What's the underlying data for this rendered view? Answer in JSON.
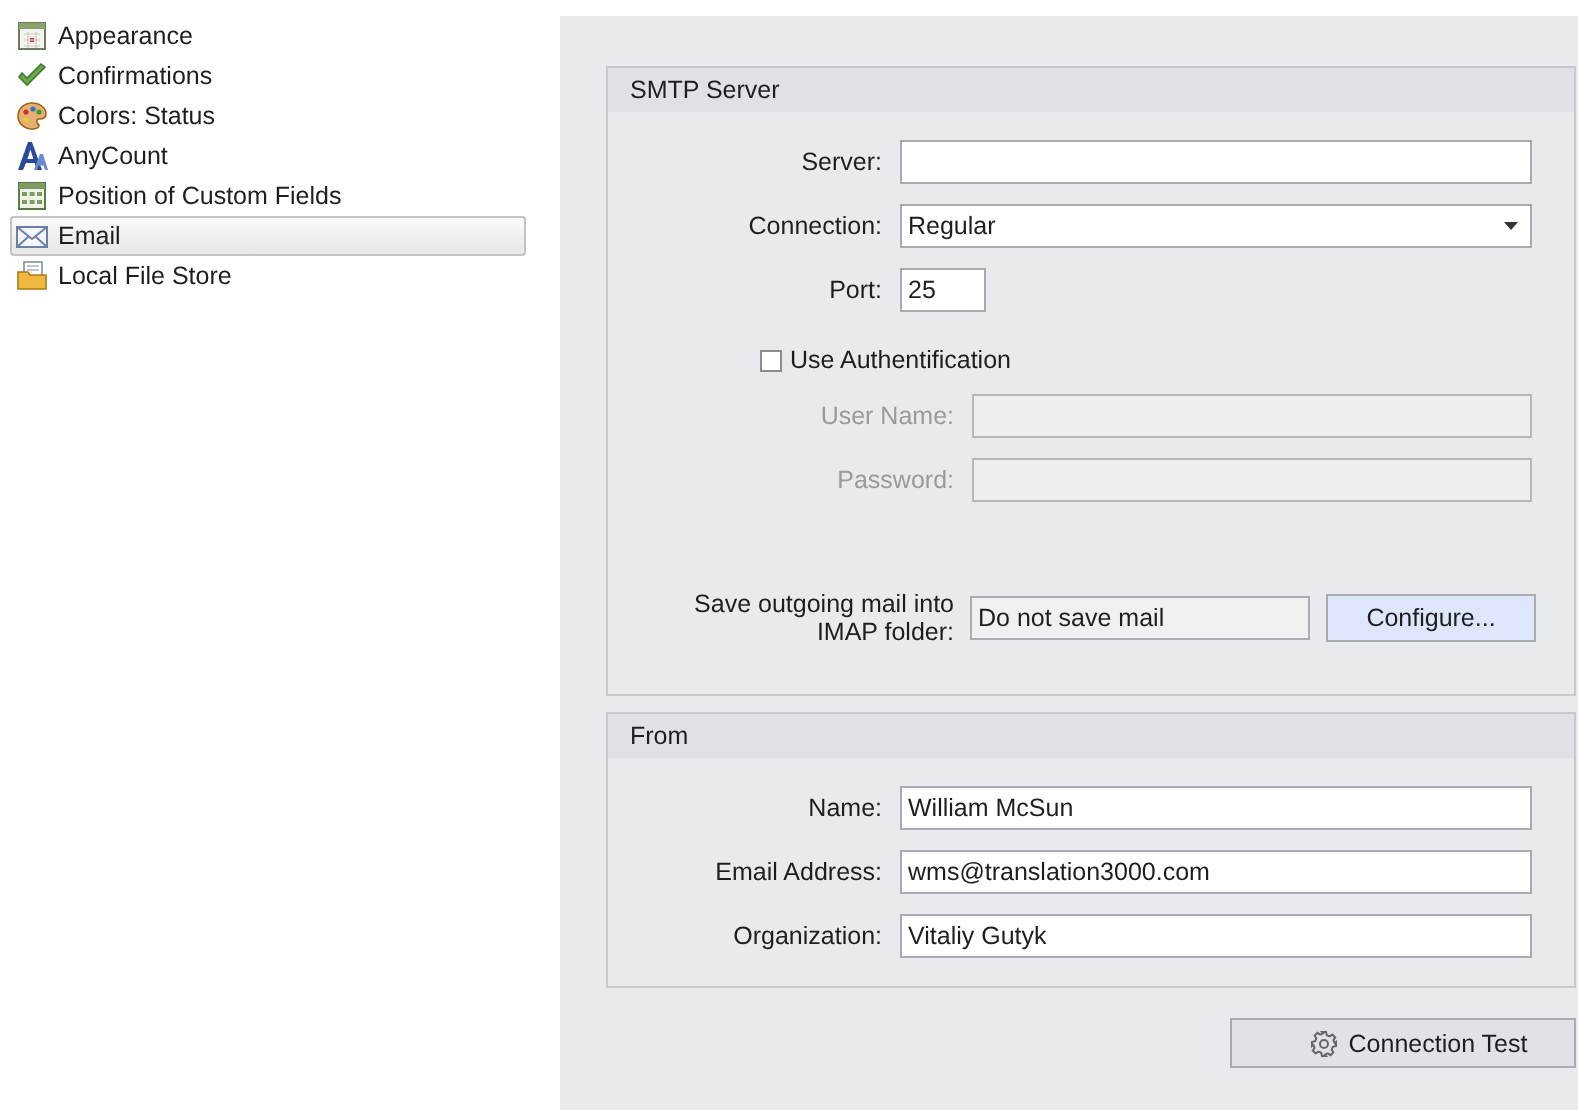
{
  "sidebar": {
    "items": [
      {
        "label": "Appearance",
        "selected": false
      },
      {
        "label": "Confirmations",
        "selected": false
      },
      {
        "label": "Colors: Status",
        "selected": false
      },
      {
        "label": "AnyCount",
        "selected": false
      },
      {
        "label": "Position of Custom Fields",
        "selected": false
      },
      {
        "label": "Email",
        "selected": true
      },
      {
        "label": "Local File Store",
        "selected": false
      }
    ]
  },
  "smtp_server": {
    "title": "SMTP Server",
    "fields": [
      {
        "kind": "text",
        "label": "Server:",
        "disabled": false
      },
      {
        "kind": "select",
        "label": "Connection:",
        "value": "Regular"
      },
      {
        "kind": "short",
        "label": "Port:",
        "value": "25"
      },
      {
        "kind": "checkbox",
        "label": "Use Authentification",
        "checked": false
      },
      {
        "kind": "indented",
        "label": "User Name:",
        "disabled": true
      },
      {
        "kind": "indented",
        "label": "Password:",
        "disabled": true
      },
      {
        "kind": "folder",
        "label": "Save outgoing mail into IMAP folder:",
        "value": "Do not save mail",
        "button": "Configure..."
      }
    ]
  },
  "from": {
    "title": "From",
    "fields": [
      {
        "kind": "text",
        "label": "Name:",
        "value": "William McSun",
        "disabled": false
      },
      {
        "kind": "text",
        "label": "Email Address:",
        "value": "wms@translation3000.com",
        "disabled": false
      },
      {
        "kind": "text",
        "label": "Organization:",
        "value": "Vitaliy Gutyk",
        "disabled": false
      }
    ]
  },
  "connection_test_button": "Connection Test"
}
